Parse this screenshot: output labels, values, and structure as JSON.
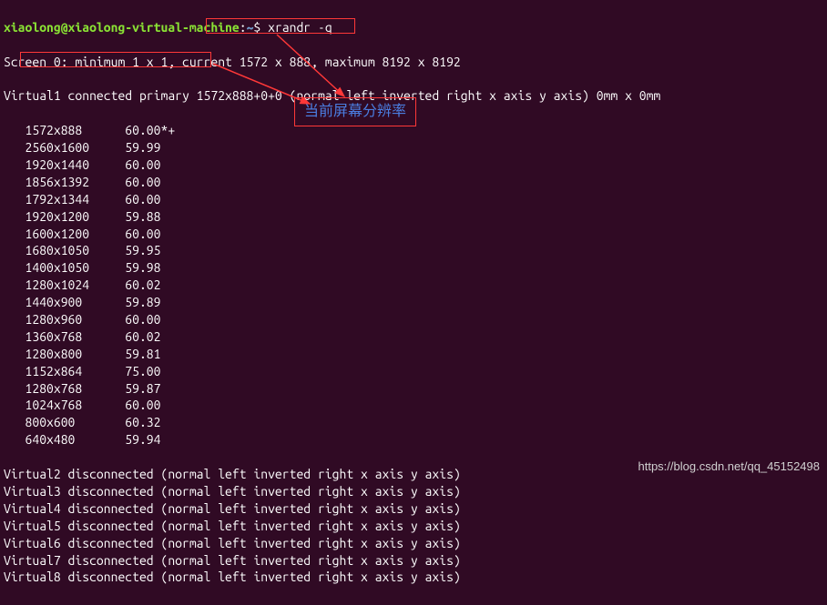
{
  "prompt": {
    "user_host": "xiaolong@xiaolong-virtual-machine",
    "path": "~",
    "command": "xrandr -q"
  },
  "screen_line": {
    "prefix": "Screen 0: minimum 1 x 1, ",
    "current": "current 1572 x 888",
    "suffix": ", maximum 8192 x 8192"
  },
  "virtual1_line": "Virtual1 connected primary 1572x888+0+0 (normal left inverted right x axis y axis) 0mm x 0mm",
  "modes": [
    {
      "res": "1572x888",
      "rate": "60.00*+"
    },
    {
      "res": "2560x1600",
      "rate": "59.99"
    },
    {
      "res": "1920x1440",
      "rate": "60.00"
    },
    {
      "res": "1856x1392",
      "rate": "60.00"
    },
    {
      "res": "1792x1344",
      "rate": "60.00"
    },
    {
      "res": "1920x1200",
      "rate": "59.88"
    },
    {
      "res": "1600x1200",
      "rate": "60.00"
    },
    {
      "res": "1680x1050",
      "rate": "59.95"
    },
    {
      "res": "1400x1050",
      "rate": "59.98"
    },
    {
      "res": "1280x1024",
      "rate": "60.02"
    },
    {
      "res": "1440x900",
      "rate": "59.89"
    },
    {
      "res": "1280x960",
      "rate": "60.00"
    },
    {
      "res": "1360x768",
      "rate": "60.02"
    },
    {
      "res": "1280x800",
      "rate": "59.81"
    },
    {
      "res": "1152x864",
      "rate": "75.00"
    },
    {
      "res": "1280x768",
      "rate": "59.87"
    },
    {
      "res": "1024x768",
      "rate": "60.00"
    },
    {
      "res": "800x600",
      "rate": "60.32"
    },
    {
      "res": "640x480",
      "rate": "59.94"
    }
  ],
  "disconnected": [
    "Virtual2 disconnected (normal left inverted right x axis y axis)",
    "Virtual3 disconnected (normal left inverted right x axis y axis)",
    "Virtual4 disconnected (normal left inverted right x axis y axis)",
    "Virtual5 disconnected (normal left inverted right x axis y axis)",
    "Virtual6 disconnected (normal left inverted right x axis y axis)",
    "Virtual7 disconnected (normal left inverted right x axis y axis)",
    "Virtual8 disconnected (normal left inverted right x axis y axis)"
  ],
  "annotation": {
    "label": "当前屏幕分辨率"
  },
  "watermark": "https://blog.csdn.net/qq_45152498"
}
